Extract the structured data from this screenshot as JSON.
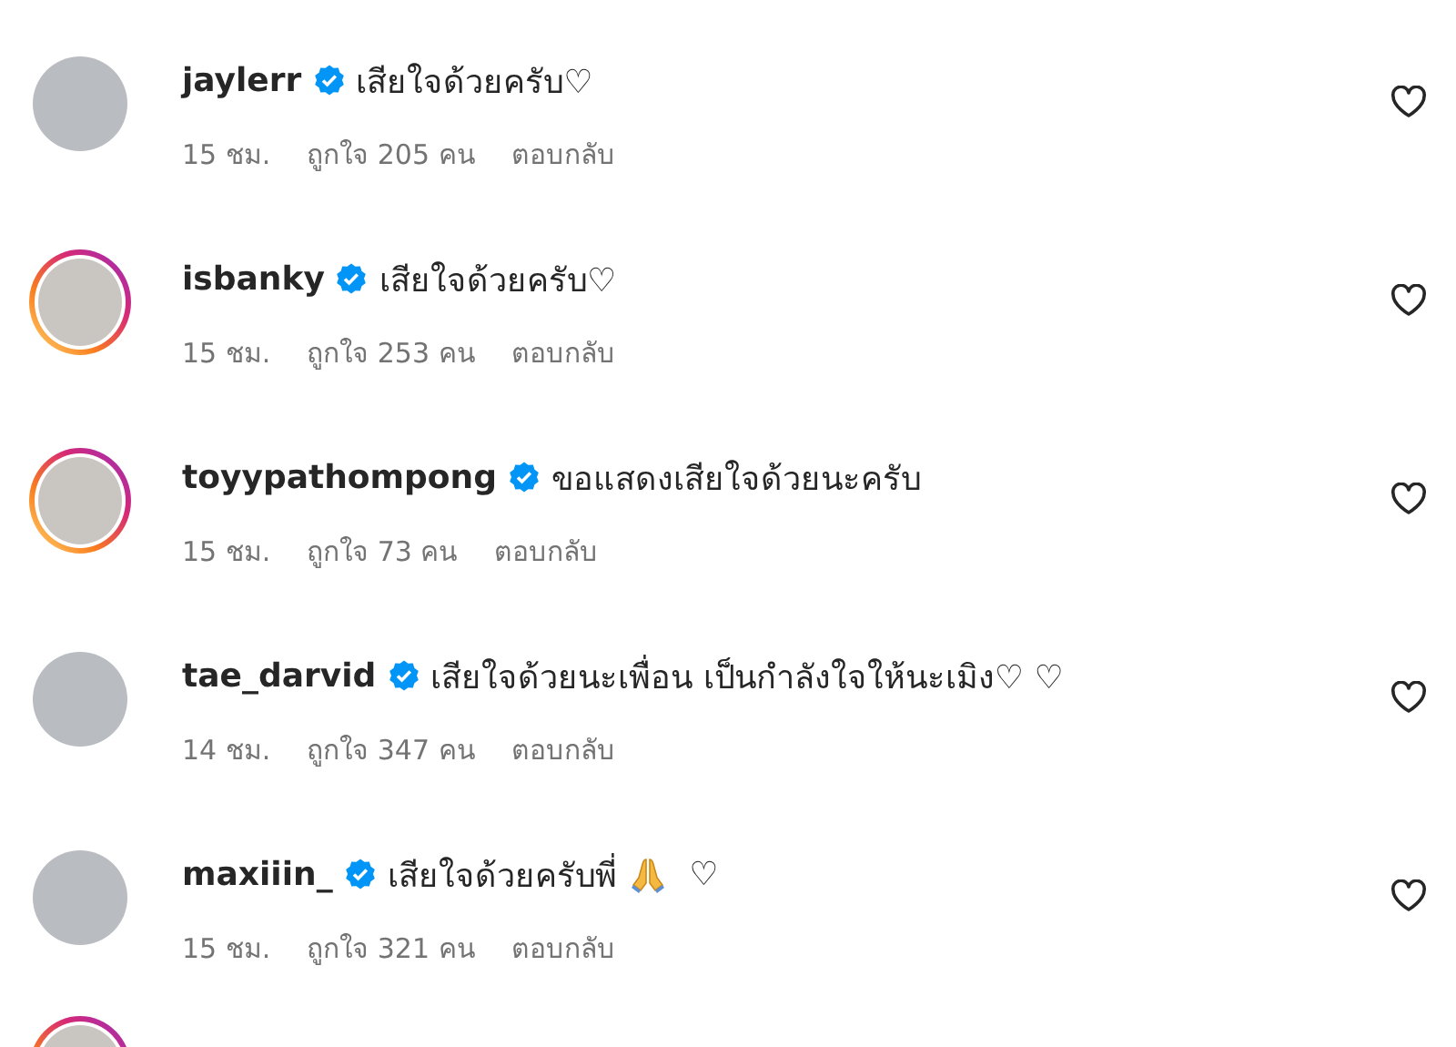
{
  "comments": [
    {
      "username": "jaylerr",
      "verified": true,
      "story_ring": false,
      "parts": [
        {
          "kind": "text",
          "text": "เสียใจด้วยครับ♡"
        }
      ],
      "time": "15 ชม.",
      "likes": "ถูกใจ 205 คน",
      "reply": "ตอบกลับ"
    },
    {
      "username": "isbanky",
      "verified": true,
      "story_ring": true,
      "parts": [
        {
          "kind": "text",
          "text": "เสียใจด้วยครับ♡"
        }
      ],
      "time": "15 ชม.",
      "likes": "ถูกใจ 253 คน",
      "reply": "ตอบกลับ"
    },
    {
      "username": "toyypathompong",
      "verified": true,
      "story_ring": true,
      "parts": [
        {
          "kind": "text",
          "text": "ขอแสดงเสียใจด้วยนะครับ"
        }
      ],
      "time": "15 ชม.",
      "likes": "ถูกใจ 73 คน",
      "reply": "ตอบกลับ"
    },
    {
      "username": "tae_darvid",
      "verified": true,
      "story_ring": false,
      "parts": [
        {
          "kind": "text",
          "text": "เสียใจด้วยนะเพื่อน เป็นกำลังใจให้นะเมิง♡ ♡"
        }
      ],
      "time": "14 ชม.",
      "likes": "ถูกใจ 347 คน",
      "reply": "ตอบกลับ"
    },
    {
      "username": "maxiiin_",
      "verified": true,
      "story_ring": false,
      "parts": [
        {
          "kind": "text",
          "text": "เสียใจด้วยครับพี่"
        },
        {
          "kind": "pray"
        },
        {
          "kind": "text",
          "text": " ♡"
        }
      ],
      "time": "15 ชม.",
      "likes": "ถูกใจ 321 คน",
      "reply": "ตอบกลับ"
    }
  ],
  "next_comment": {
    "story_ring": true
  }
}
